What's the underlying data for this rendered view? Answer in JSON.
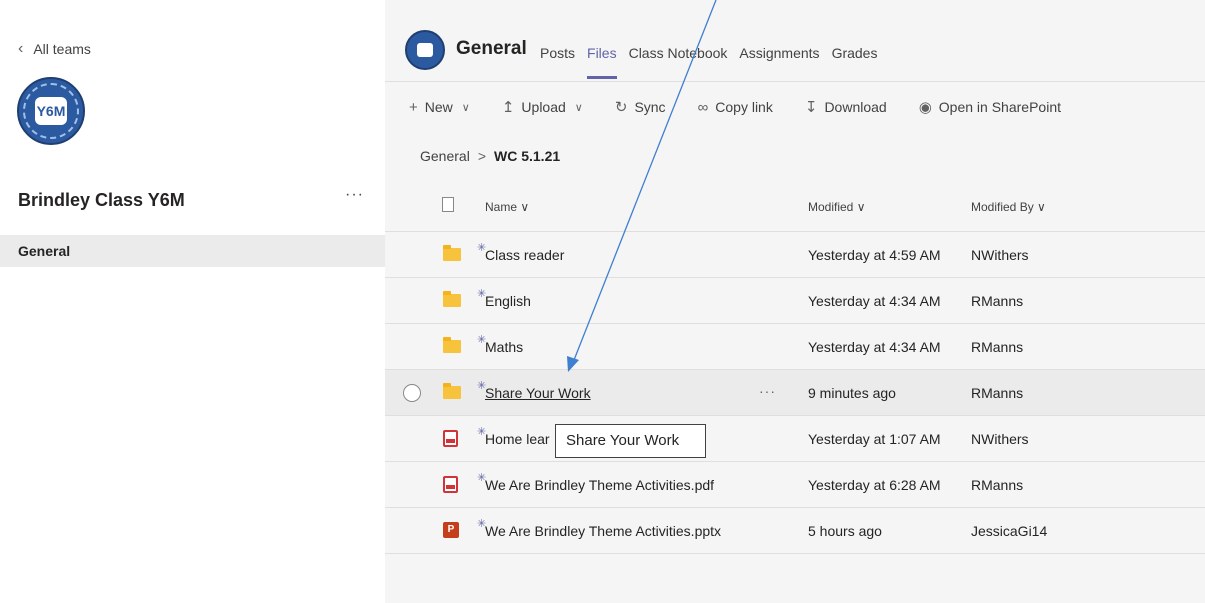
{
  "sidebar": {
    "back_label": "All teams",
    "team_logo_text": "Y6M",
    "team_name": "Brindley Class Y6M",
    "more_label": "···",
    "channels": [
      {
        "label": "General"
      }
    ]
  },
  "header": {
    "channel_title": "General",
    "tabs": [
      {
        "label": "Posts"
      },
      {
        "label": "Files"
      },
      {
        "label": "Class Notebook"
      },
      {
        "label": "Assignments"
      },
      {
        "label": "Grades"
      }
    ],
    "active_tab": "Files"
  },
  "toolbar": {
    "new_label": "New",
    "upload_label": "Upload",
    "sync_label": "Sync",
    "copy_link_label": "Copy link",
    "download_label": "Download",
    "open_sharepoint_label": "Open in SharePoint"
  },
  "breadcrumb": {
    "root": "General",
    "separator": ">",
    "current": "WC 5.1.21"
  },
  "table": {
    "columns": {
      "name": "Name",
      "modified": "Modified",
      "modified_by": "Modified By"
    },
    "rows": [
      {
        "name": "Class reader",
        "modified": "Yesterday at 4:59 AM",
        "modified_by": "NWithers",
        "type": "folder"
      },
      {
        "name": "English",
        "modified": "Yesterday at 4:34 AM",
        "modified_by": "RManns",
        "type": "folder"
      },
      {
        "name": "Maths",
        "modified": "Yesterday at 4:34 AM",
        "modified_by": "RManns",
        "type": "folder"
      },
      {
        "name": "Share Your Work",
        "modified": "9 minutes ago",
        "modified_by": "RManns",
        "type": "folder",
        "more": "···"
      },
      {
        "name": "Home lear",
        "modified": "Yesterday at 1:07 AM",
        "modified_by": "NWithers",
        "type": "pdf"
      },
      {
        "name": "We Are Brindley Theme Activities.pdf",
        "modified": "Yesterday at 6:28 AM",
        "modified_by": "RManns",
        "type": "pdf"
      },
      {
        "name": "We Are Brindley Theme Activities.pptx",
        "modified": "5 hours ago",
        "modified_by": "JessicaGi14",
        "type": "pptx"
      }
    ]
  },
  "tooltip": {
    "text": "Share Your Work"
  },
  "colors": {
    "accent": "#6264a7",
    "folder": "#f8c33c",
    "pdf": "#d13438",
    "ppt": "#c43e1c",
    "annotation_arrow": "#3f7fcf"
  }
}
